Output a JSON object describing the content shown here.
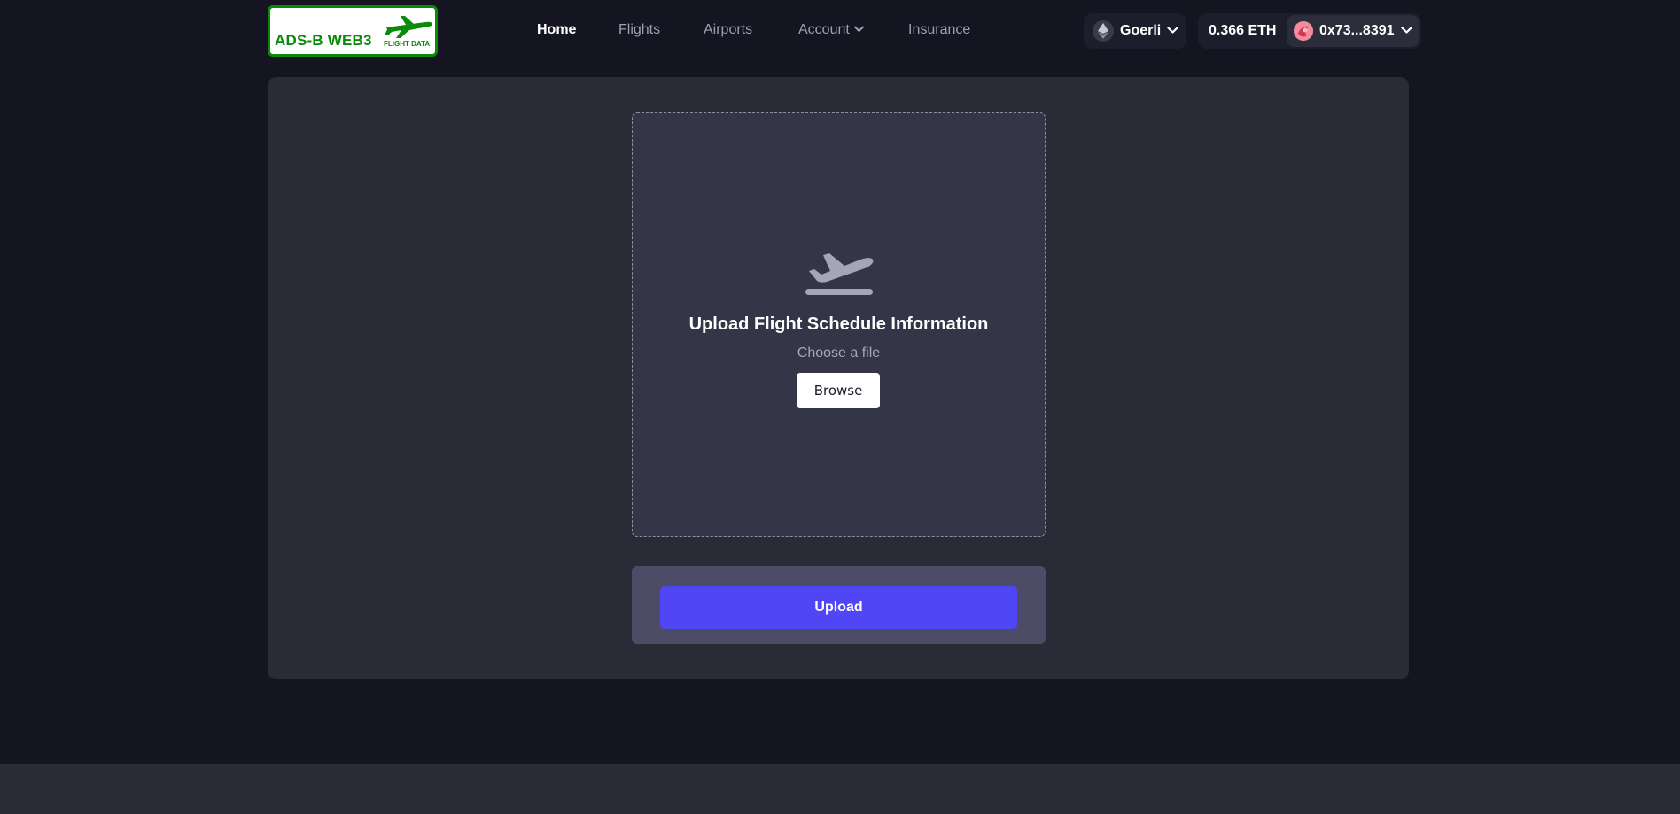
{
  "header": {
    "logo": {
      "text": "ADS-B WEB3",
      "subtext": "FLIGHT DATA"
    },
    "nav": [
      {
        "label": "Home",
        "active": true
      },
      {
        "label": "Flights",
        "active": false
      },
      {
        "label": "Airports",
        "active": false
      },
      {
        "label": "Account",
        "active": false,
        "has_dropdown": true
      },
      {
        "label": "Insurance",
        "active": false
      }
    ],
    "network": {
      "label": "Goerli",
      "icon": "ethereum-icon"
    },
    "wallet": {
      "balance": "0.366 ETH",
      "address": "0x73...8391"
    }
  },
  "main": {
    "dropzone": {
      "icon": "plane-departure-icon",
      "title": "Upload Flight Schedule Information",
      "subtitle": "Choose a file",
      "browse_label": "Browse"
    },
    "upload_label": "Upload"
  },
  "colors": {
    "background": "#141521",
    "card": "#2b2b38",
    "dropzone": "#353548",
    "accent": "#5146f5",
    "logo_green": "#0a8a0a"
  }
}
